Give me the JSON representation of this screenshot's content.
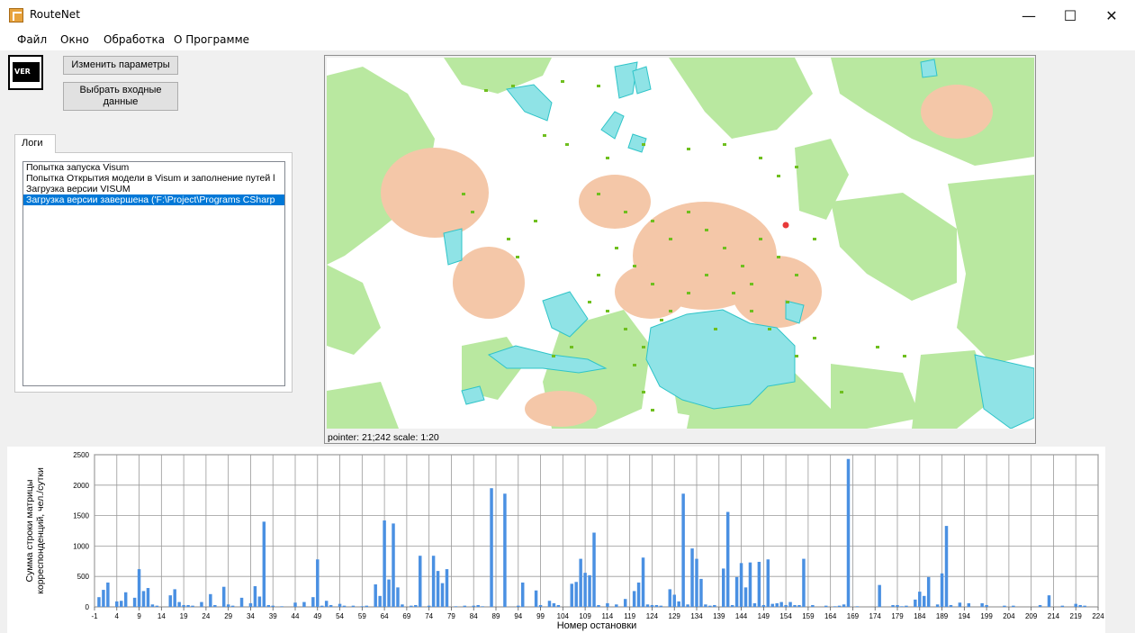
{
  "window": {
    "title": "RouteNet",
    "controls": {
      "minimize": "—",
      "maximize": "☐",
      "close": "✕"
    }
  },
  "menu": [
    "Файл",
    "Окно",
    "Обработка",
    "О Программе"
  ],
  "toolbar": {
    "icon_text": "VER",
    "change_params_label": "Изменить параметры",
    "select_input_label": "Выбрать входные данные"
  },
  "logs": {
    "tab_label": "Логи",
    "items": [
      "Попытка запуска Visum",
      "Попытка Открытия модели в Visum и заполнение путей l",
      "Загрузка версии VISUM",
      "Загрузка версии завершена ('F:\\Project\\Programs CSharp"
    ],
    "selected_index": 3
  },
  "map": {
    "status": "pointer: 21;242 scale: 1:20",
    "colors": {
      "park": "#b9e8a0",
      "water": "#8fe3e6",
      "water_border": "#2fc4c8",
      "stop": "#6fbf1f",
      "building": "#f4c7a8",
      "marker": "#e83a3a"
    }
  },
  "chart_data": {
    "type": "bar",
    "ylabel": "Сумма строки матрицы корреспонденций, чел./сутки",
    "xlabel": "Номер остановки",
    "ylim": [
      0,
      2500
    ],
    "xlim": [
      -1,
      224
    ],
    "yticks": [
      0,
      500,
      1000,
      1500,
      2000,
      2500
    ],
    "xticks": [
      -1,
      4,
      9,
      14,
      19,
      24,
      29,
      34,
      39,
      44,
      49,
      54,
      59,
      64,
      69,
      74,
      79,
      84,
      89,
      94,
      99,
      104,
      109,
      114,
      119,
      124,
      129,
      134,
      139,
      144,
      149,
      154,
      159,
      164,
      169,
      174,
      179,
      184,
      189,
      194,
      199,
      204,
      209,
      214,
      219,
      224
    ],
    "grid": true,
    "color": "#4a90e2",
    "x": [
      0,
      1,
      2,
      4,
      5,
      6,
      8,
      9,
      10,
      11,
      12,
      13,
      16,
      17,
      18,
      19,
      20,
      21,
      23,
      25,
      26,
      28,
      29,
      30,
      32,
      34,
      35,
      36,
      37,
      38,
      39,
      41,
      44,
      46,
      48,
      49,
      50,
      51,
      52,
      54,
      55,
      57,
      59,
      60,
      62,
      63,
      64,
      65,
      66,
      67,
      68,
      70,
      71,
      72,
      74,
      75,
      76,
      77,
      78,
      80,
      82,
      84,
      85,
      86,
      88,
      91,
      94,
      95,
      98,
      99,
      101,
      102,
      103,
      106,
      107,
      108,
      109,
      110,
      111,
      112,
      114,
      116,
      118,
      120,
      121,
      122,
      123,
      124,
      125,
      126,
      128,
      129,
      130,
      131,
      132,
      133,
      134,
      135,
      136,
      137,
      138,
      140,
      141,
      142,
      143,
      144,
      145,
      146,
      147,
      148,
      149,
      150,
      151,
      152,
      153,
      154,
      155,
      156,
      157,
      158,
      160,
      163,
      165,
      166,
      167,
      168,
      170,
      175,
      178,
      179,
      180,
      181,
      183,
      184,
      185,
      186,
      188,
      189,
      190,
      191,
      193,
      195,
      198,
      199,
      203,
      205,
      211,
      213,
      216,
      219,
      220,
      221
    ],
    "values": [
      160,
      280,
      400,
      90,
      100,
      240,
      150,
      620,
      260,
      310,
      40,
      20,
      190,
      290,
      80,
      30,
      30,
      20,
      80,
      210,
      30,
      330,
      40,
      20,
      150,
      60,
      340,
      170,
      1400,
      30,
      20,
      10,
      70,
      80,
      160,
      780,
      20,
      100,
      30,
      50,
      20,
      20,
      10,
      20,
      370,
      180,
      1420,
      450,
      1370,
      320,
      40,
      20,
      30,
      840,
      20,
      840,
      590,
      390,
      620,
      10,
      20,
      20,
      30,
      10,
      1950,
      1860,
      20,
      400,
      270,
      30,
      100,
      60,
      30,
      380,
      410,
      790,
      560,
      520,
      1220,
      30,
      60,
      40,
      130,
      260,
      400,
      810,
      40,
      30,
      30,
      20,
      290,
      200,
      90,
      1860,
      40,
      960,
      790,
      460,
      40,
      20,
      30,
      630,
      1560,
      30,
      490,
      720,
      320,
      730,
      60,
      740,
      30,
      780,
      50,
      60,
      80,
      30,
      80,
      30,
      30,
      790,
      30,
      20,
      10,
      20,
      40,
      2430,
      10,
      360,
      30,
      30,
      10,
      20,
      120,
      250,
      180,
      490,
      40,
      550,
      1330,
      30,
      70,
      60,
      60,
      30,
      20,
      20,
      30,
      190,
      20,
      50,
      30,
      20,
      10,
      180,
      210,
      80
    ]
  }
}
